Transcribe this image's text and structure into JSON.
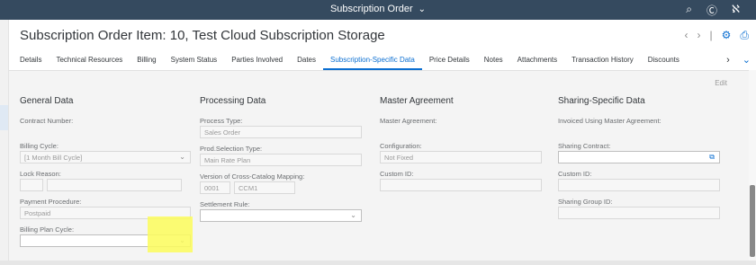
{
  "shell": {
    "title": "Subscription Order"
  },
  "header": {
    "title": "Subscription Order Item: 10, Test Cloud Subscription Storage"
  },
  "tabs": [
    {
      "label": "Details"
    },
    {
      "label": "Technical Resources"
    },
    {
      "label": "Billing"
    },
    {
      "label": "System Status"
    },
    {
      "label": "Parties Involved"
    },
    {
      "label": "Dates"
    },
    {
      "label": "Subscription-Specific Data"
    },
    {
      "label": "Price Details"
    },
    {
      "label": "Notes"
    },
    {
      "label": "Attachments"
    },
    {
      "label": "Transaction History"
    },
    {
      "label": "Discounts"
    }
  ],
  "edit_label": "Edit",
  "general": {
    "title": "General Data",
    "contract_number": "Contract Number:",
    "billing_cycle_label": "Billing Cycle:",
    "billing_cycle_value": "[1 Month  Bill Cycle]",
    "lock_reason_label": "Lock Reason:",
    "payment_procedure_label": "Payment Procedure:",
    "payment_procedure_value": "Postpaid",
    "billing_plan_cycle_label": "Billing Plan Cycle:"
  },
  "processing": {
    "title": "Processing Data",
    "process_type_label": "Process Type:",
    "process_type_value": "Sales Order",
    "prod_selection_label": "Prod.Selection Type:",
    "prod_selection_value": "Main Rate Plan",
    "version_label": "Version of Cross-Catalog Mapping:",
    "version_value_1": "0001",
    "version_value_2": "CCM1",
    "settlement_rule_label": "Settlement Rule:"
  },
  "master": {
    "title": "Master Agreement",
    "master_agreement_label": "Master Agreement:",
    "configuration_label": "Configuration:",
    "configuration_value": "Not Fixed",
    "custom_id_label": "Custom ID:"
  },
  "sharing": {
    "title": "Sharing-Specific Data",
    "invoiced_label": "Invoiced Using Master Agreement:",
    "sharing_contract_label": "Sharing Contract:",
    "custom_id_label": "Custom ID:",
    "sharing_group_label": "Sharing Group ID:"
  }
}
